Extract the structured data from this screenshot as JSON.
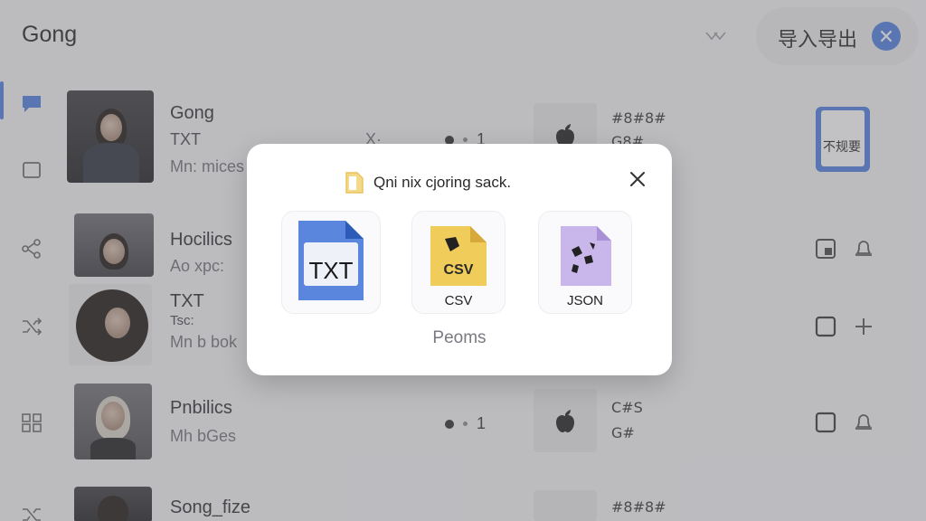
{
  "header": {
    "title": "Gong",
    "io_label": "导入导出"
  },
  "sidebar": {
    "icons": [
      "chat-icon",
      "square-icon",
      "share-icon",
      "shuffle-icon",
      "grid-icon",
      "shuffle-icon"
    ]
  },
  "rows": [
    {
      "title": "Gong",
      "sub": "TXT",
      "meta": "Mn: mices",
      "extra": "X·",
      "count": "1",
      "code1": "#8#8#",
      "code2": "G8#"
    },
    {
      "title": "Hocilics",
      "sub": "Ao xpc:",
      "meta": ""
    },
    {
      "title": "TXT",
      "sub": "Tsc:",
      "meta": "Mn b bok"
    },
    {
      "title": "Pnbilics",
      "sub": "Mh bGes",
      "meta": "",
      "count": "1",
      "code1": "C#S",
      "code2": "G#"
    },
    {
      "title": "Song_fize",
      "sub": "",
      "meta": "",
      "code1": "#8#8#"
    }
  ],
  "side_tile": {
    "label": "不规要"
  },
  "dialog": {
    "title": "Qni nix cjoring sack.",
    "formats": [
      {
        "label": "TXT",
        "icon": "txt-file-icon"
      },
      {
        "label": "CSV",
        "icon": "csv-file-icon"
      },
      {
        "label": "JSON",
        "icon": "json-file-icon"
      }
    ],
    "csv_badge": "CSV",
    "footer": "Peoms"
  },
  "colors": {
    "accent": "#4a7be0",
    "csv": "#f0cc5a",
    "json": "#c9b6ea"
  }
}
